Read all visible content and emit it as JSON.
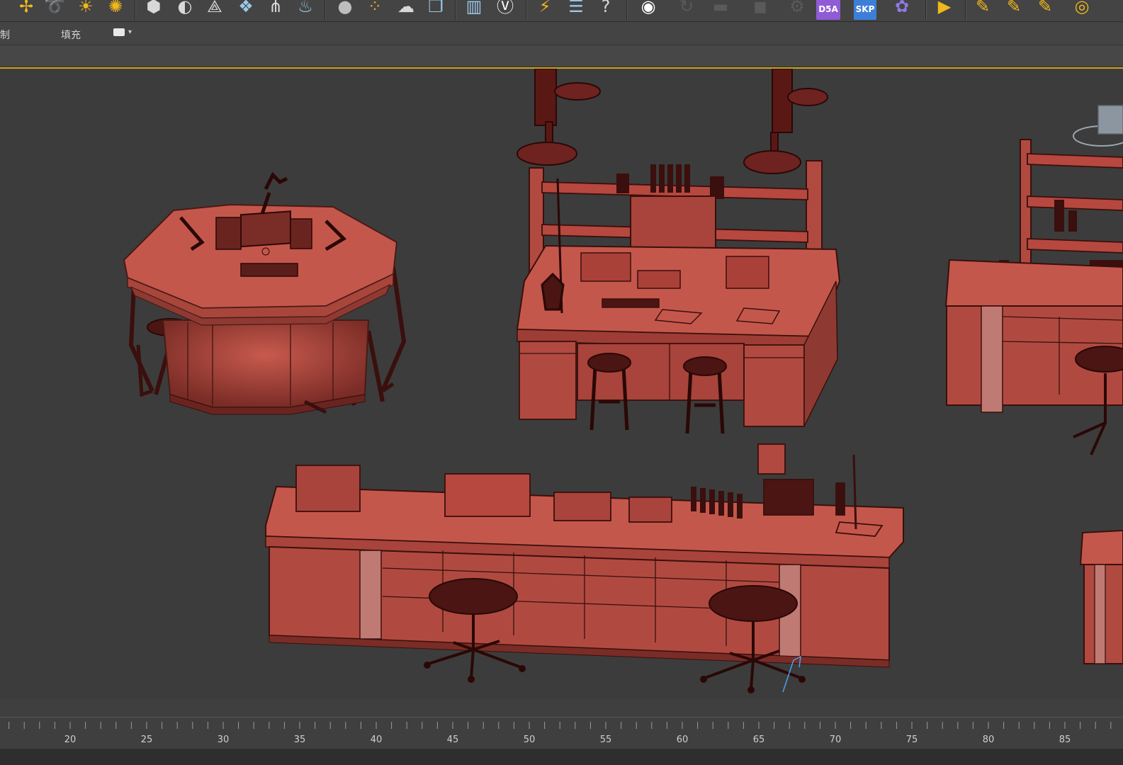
{
  "toolbar": {
    "icons": [
      "create-icon",
      "helper-icon",
      "light-icon",
      "sunburst-icon",
      "material-editor-icon",
      "render-setup-icon",
      "particle-icon",
      "space-warp-icon",
      "grass-icon",
      "fire-icon",
      "sphere-icon",
      "spheres-icon",
      "link-icon",
      "layers-icon",
      "scene-explorer-icon",
      "vray-icon",
      "lightning-icon",
      "list-icon",
      "help-icon",
      "render-icon",
      "undo-icon",
      "camera-icon",
      "snapshot-icon",
      "gear-icon",
      "d5a-icon",
      "skp-icon",
      "flower-icon",
      "play-icon",
      "edit-icon",
      "edit2-icon",
      "edit3-icon",
      "eye-icon"
    ],
    "d5a_label": "D5A",
    "skp_label": "SKP"
  },
  "subbar": {
    "left_label": "制",
    "fill_label": "填充"
  },
  "viewport": {
    "name": "perspective-viewport",
    "accent_color": "#c9a51a",
    "model_color": "#c0564a"
  },
  "ruler": {
    "ticks": [
      "20",
      "25",
      "30",
      "35",
      "40",
      "45",
      "50",
      "55",
      "60",
      "65",
      "70",
      "75",
      "80",
      "85"
    ]
  }
}
